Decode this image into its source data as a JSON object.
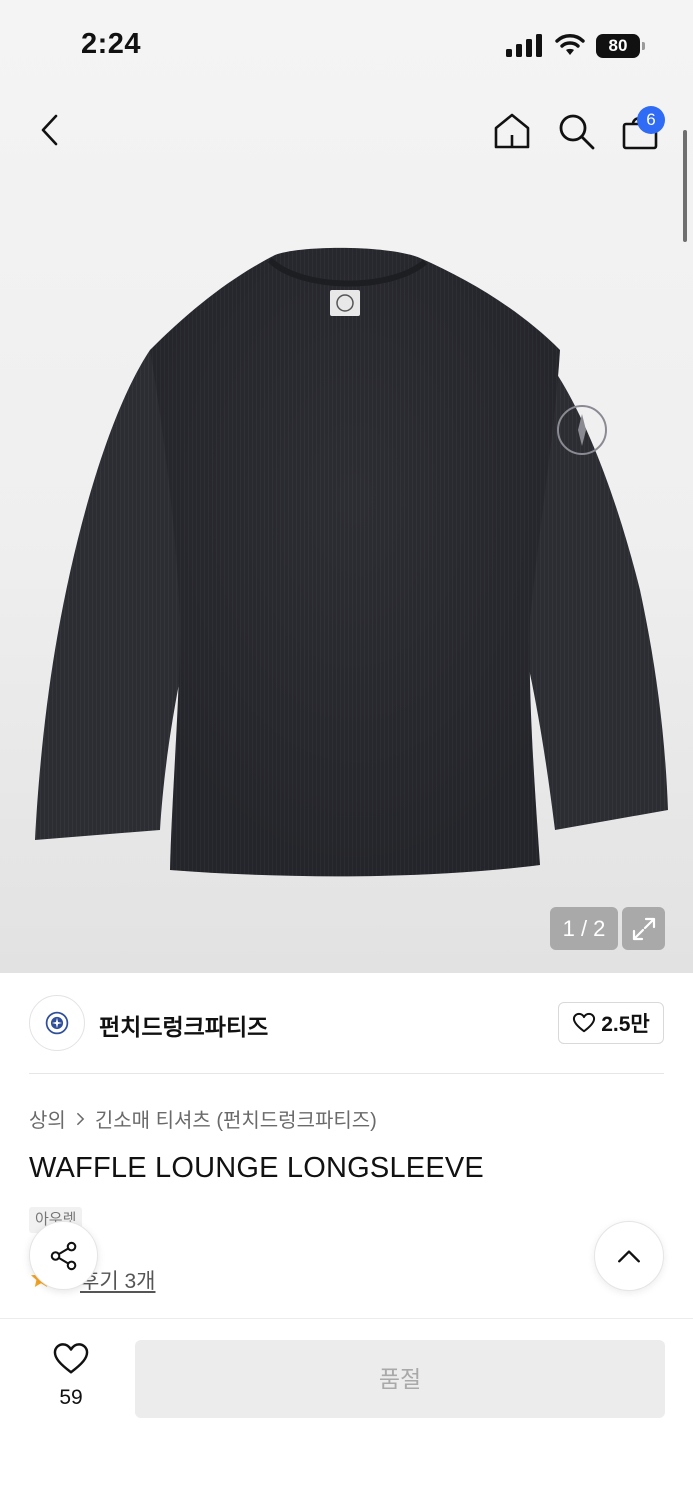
{
  "status_bar": {
    "time": "2:24",
    "battery": "80"
  },
  "header": {
    "back_icon": "chevron-left-icon",
    "home_icon": "home-icon",
    "search_icon": "search-icon",
    "bag_icon": "shopping-bag-icon",
    "cart_count": "6"
  },
  "gallery": {
    "counter": "1 / 2",
    "expand_icon": "expand-icon"
  },
  "brand": {
    "name": "펀치드렁크파티즈",
    "likes": "2.5만"
  },
  "product": {
    "breadcrumb": [
      "상의",
      "긴소매 티셔츠 (펀치드렁크파티즈)"
    ],
    "title": "WAFFLE LOUNGE LONGSLEEVE",
    "tag": "아우렛",
    "review_text": "후기 3개"
  },
  "bottom": {
    "wish_count": "59",
    "buy_label": "품절"
  },
  "colors": {
    "accent": "#2f6bf5",
    "star": "#f5a623",
    "sweater": "#2c2d33"
  }
}
